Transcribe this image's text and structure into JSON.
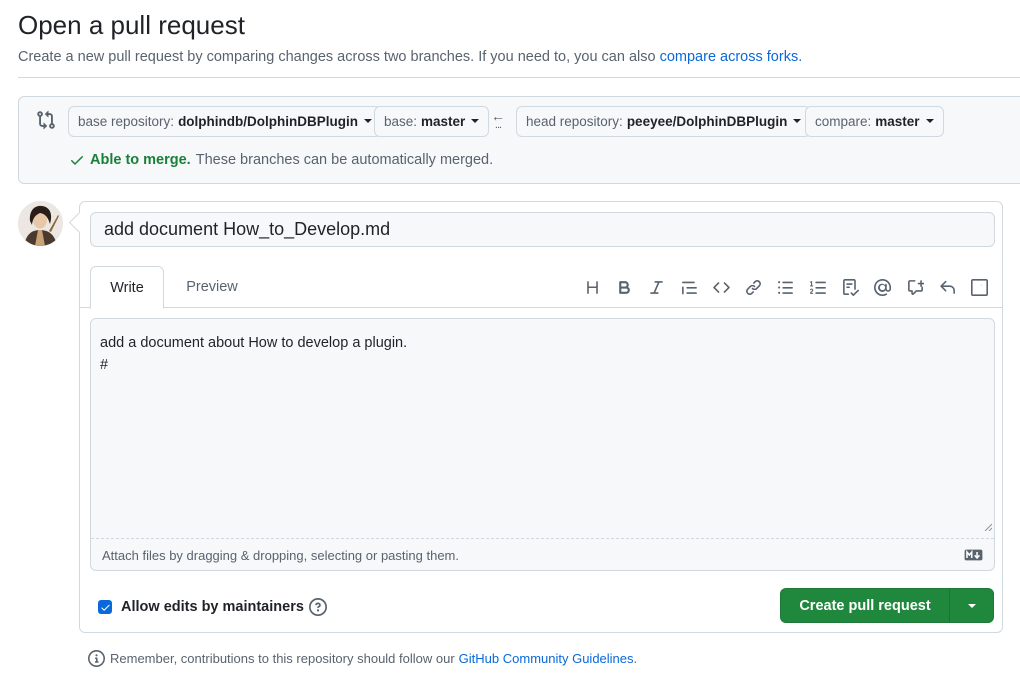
{
  "page": {
    "title": "Open a pull request",
    "subtitle": "Create a new pull request by comparing changes across two branches. If you need to, you can also",
    "subtitle_link": "compare across forks."
  },
  "range": {
    "base_repo_label": "base repository:",
    "base_repo_value": "dolphindb/DolphinDBPlugin",
    "base_label": "base:",
    "base_value": "master",
    "head_repo_label": "head repository:",
    "head_repo_value": "peeyee/DolphinDBPlugin",
    "compare_label": "compare:",
    "compare_value": "master",
    "arrow_dots": "...",
    "merge_ok": "Able to merge.",
    "merge_text": "These branches can be automatically merged."
  },
  "form": {
    "title_value": "add document How_to_Develop.md",
    "tabs": {
      "write": "Write",
      "preview": "Preview"
    },
    "toolbar": [
      "heading-icon",
      "bold-icon",
      "italic-icon",
      "quote-icon",
      "code-icon",
      "link-icon",
      "unordered-list-icon",
      "ordered-list-icon",
      "task-list-icon",
      "mention-icon",
      "cross-reference-icon",
      "reply-icon",
      "slash-commands-icon"
    ],
    "body_value": "add a document about How to develop a plugin.\n#",
    "attach_text": "Attach files by dragging & dropping, selecting or pasting them.",
    "allow_edits_label": "Allow edits by maintainers",
    "allow_edits_checked": true,
    "create_label": "Create pull request"
  },
  "footer": {
    "note": "Remember, contributions to this repository should follow our",
    "note_link": "GitHub Community Guidelines",
    "note_end": "."
  },
  "colors": {
    "accent": "#0969da",
    "success": "#1a7f37",
    "primary_button": "#1f883d"
  }
}
